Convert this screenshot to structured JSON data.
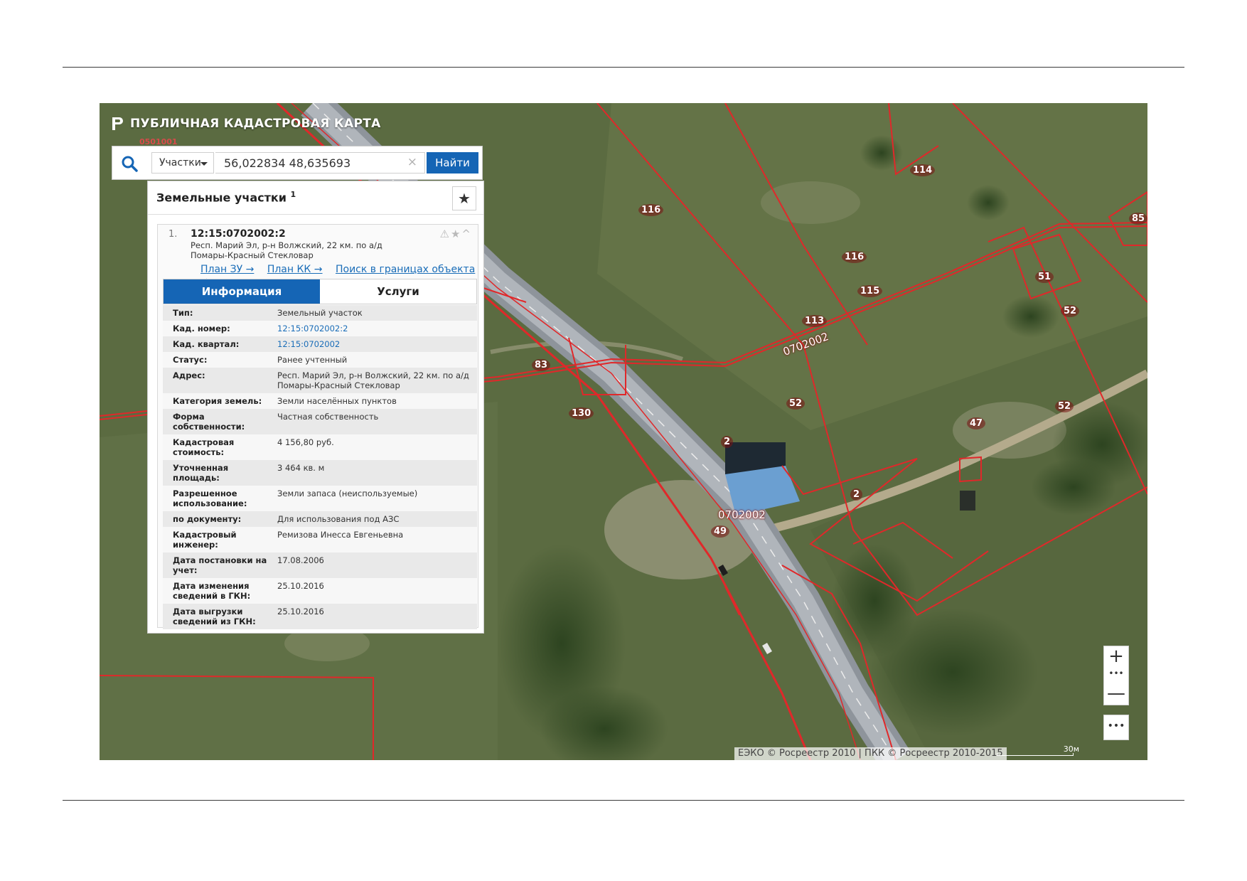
{
  "app": {
    "title": "ПУБЛИЧНАЯ КАДАСТРОВАЯ КАРТА",
    "partial_label": "0501001"
  },
  "search": {
    "type_label": "Участки",
    "query": "56,022834 48,635693",
    "clear_icon": "×",
    "button_label": "Найти"
  },
  "panel": {
    "title": "Земельные участки",
    "count": "1",
    "favorite_icon": "★",
    "result": {
      "index": "1.",
      "cad_number": "12:15:0702002:2",
      "address": "Респ. Марий Эл, р-н Волжский, 22 км. по а/д Помары-Красный Стекловар",
      "tools": "⚠★^",
      "links": [
        "План ЗУ →",
        "План КК →",
        "Поиск в границах объекта →"
      ],
      "tabs": [
        "Информация",
        "Услуги"
      ],
      "active_tab": "Информация",
      "rows": [
        {
          "k": "Тип:",
          "v": "Земельный участок"
        },
        {
          "k": "Кад. номер:",
          "v": "12:15:0702002:2"
        },
        {
          "k": "Кад. квартал:",
          "v": "12:15:0702002"
        },
        {
          "k": "Статус:",
          "v": "Ранее учтенный"
        },
        {
          "k": "Адрес:",
          "v": "Респ. Марий Эл, р-н Волжский, 22 км. по а/д Помары-Красный Стекловар"
        },
        {
          "k": "Категория земель:",
          "v": "Земли населённых пунктов"
        },
        {
          "k": "Форма собственности:",
          "v": "Частная собственность"
        },
        {
          "k": "Кадастровая стоимость:",
          "v": "4 156,80 руб."
        },
        {
          "k": "Уточненная площадь:",
          "v": "3 464 кв. м"
        },
        {
          "k": "Разрешенное использование:",
          "v": "Земли запаса (неиспользуемые)"
        },
        {
          "k": "по документу:",
          "v": "Для использования под АЗС"
        },
        {
          "k": "Кадастровый инженер:",
          "v": "Ремизова Инесса Евгеньевна"
        },
        {
          "k": "Дата постановки на учет:",
          "v": "17.08.2006"
        },
        {
          "k": "Дата изменения сведений в ГКН:",
          "v": "25.10.2016"
        },
        {
          "k": "Дата выгрузки сведений из ГКН:",
          "v": "25.10.2016"
        }
      ]
    }
  },
  "map": {
    "parcel_labels": [
      "116",
      "114",
      "116",
      "115",
      "113",
      "51",
      "52",
      "85",
      "83",
      "130",
      "52",
      "52",
      "2",
      "47",
      "2",
      "49"
    ],
    "quarter_labels": [
      "0702002",
      "0702002"
    ],
    "zoom_in": "+",
    "zoom_out": "—",
    "zoom_dots": "•••",
    "more": "•••",
    "attribution": "ЕЭКО © Росреестр 2010 | ПКК © Росреестр 2010-2015",
    "scale_label": "30м",
    "colors": {
      "boundary": "#e0282a",
      "brand_blue": "#1565b5",
      "link": "#1a6db8"
    }
  }
}
